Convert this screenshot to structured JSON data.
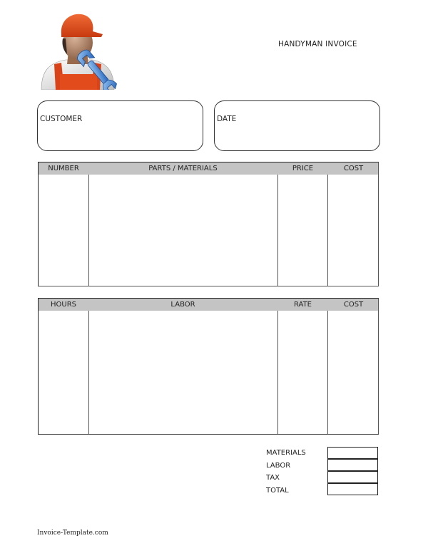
{
  "header": {
    "logo_icon": "handyman-with-wrench-icon",
    "title": "HANDYMAN INVOICE"
  },
  "info_boxes": {
    "customer_label": "CUSTOMER",
    "date_label": "DATE"
  },
  "parts_table": {
    "columns": [
      "NUMBER",
      "PARTS / MATERIALS",
      "PRICE",
      "COST"
    ],
    "rows": []
  },
  "labor_table": {
    "columns": [
      "HOURS",
      "LABOR",
      "RATE",
      "COST"
    ],
    "rows": []
  },
  "summary": {
    "items": [
      {
        "label": "MATERIALS",
        "value": ""
      },
      {
        "label": "LABOR",
        "value": ""
      },
      {
        "label": "TAX",
        "value": ""
      },
      {
        "label": "TOTAL",
        "value": ""
      }
    ]
  },
  "footer": {
    "text": "Invoice-Template.com"
  },
  "colors": {
    "header_fill": "#c4c4c4",
    "border": "#333333",
    "helmet": "#e8501e",
    "wrench": "#2f7fd6"
  }
}
